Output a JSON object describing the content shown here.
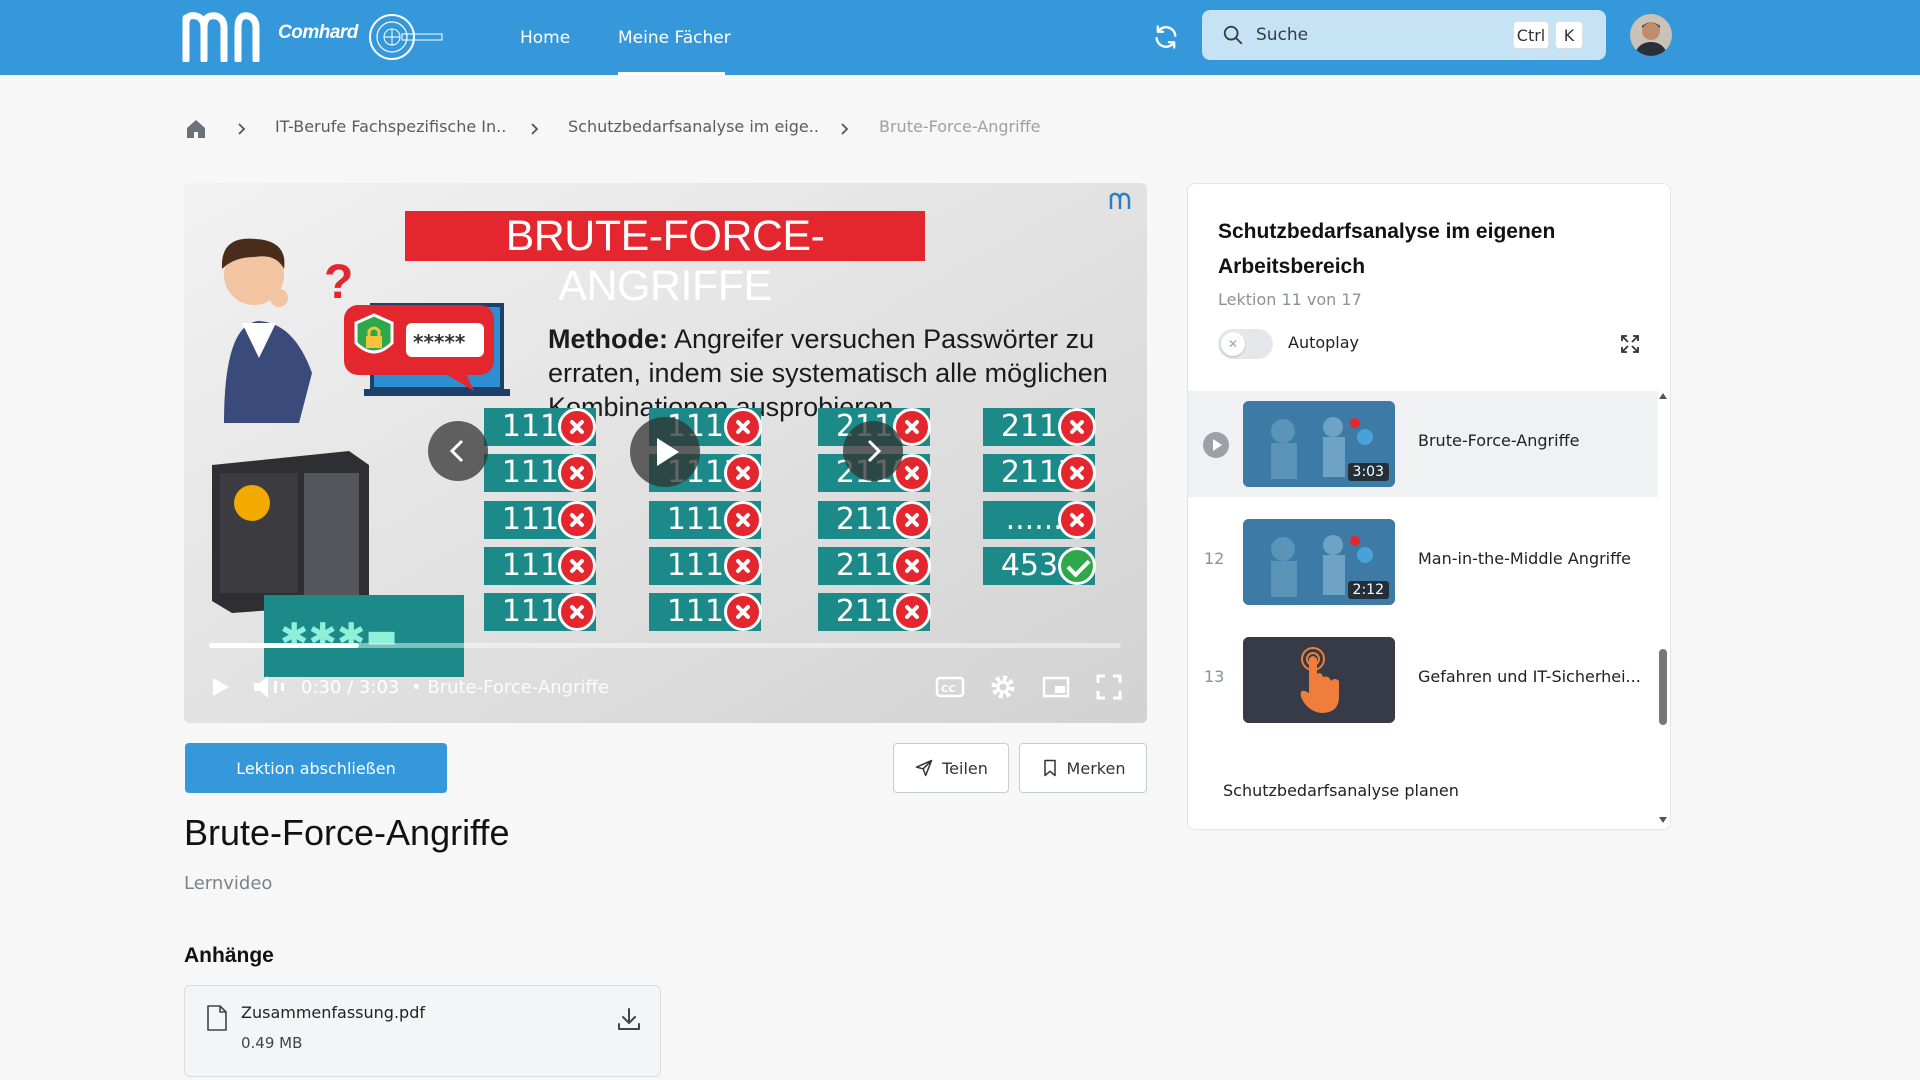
{
  "header": {
    "brand": "Comhard",
    "nav": [
      {
        "label": "Home"
      },
      {
        "label": "Meine Fächer"
      }
    ],
    "search": {
      "placeholder": "Suche",
      "key1": "Ctrl",
      "key2": "K"
    }
  },
  "breadcrumb": [
    {
      "label": "IT-Berufe Fachspezifische In.."
    },
    {
      "label": "Schutzbedarfsanalyse im eige.."
    },
    {
      "label": "Brute-Force-Angriffe"
    }
  ],
  "video": {
    "title": "BRUTE-FORCE-ANGRIFFE",
    "method_label": "Methode:",
    "method_text": "Angreifer versuchen Passwörter zu erraten, indem sie systematisch alle möglichen Kombinationen ausprobieren",
    "password_mask": "*****",
    "codes": [
      [
        "1111",
        "1116",
        "2111",
        "2116"
      ],
      [
        "1112",
        "1117",
        "2112",
        "2117"
      ],
      [
        "1113",
        "1118",
        "2113",
        "......."
      ],
      [
        "1114",
        "1119",
        "2114",
        "4539"
      ],
      [
        "1115",
        "1110",
        "2115",
        ""
      ]
    ],
    "time": "0:30 / 3:03",
    "chapter": "• Brute-Force-Angriffe",
    "progress_fraction": 0.164
  },
  "actions": {
    "complete": "Lektion abschließen",
    "share": "Teilen",
    "bookmark": "Merken"
  },
  "lesson": {
    "title": "Brute-Force-Angriffe",
    "type": "Lernvideo"
  },
  "attachments": {
    "heading": "Anhänge",
    "files": [
      {
        "name": "Zusammenfassung.pdf",
        "size": "0.49 MB"
      }
    ]
  },
  "course_panel": {
    "title": "Schutzbedarfsanalyse im eigenen Arbeitsbereich",
    "lesson_count": "Lektion 11 von 17",
    "autoplay_label": "Autoplay",
    "items": [
      {
        "index": "",
        "title": "Brute-Force-Angriffe",
        "duration": "3:03",
        "active": true
      },
      {
        "index": "12",
        "title": "Man-in-the-Middle Angriffe",
        "duration": "2:12",
        "active": false
      },
      {
        "index": "13",
        "title": "Gefahren und IT-Sicherhei...",
        "duration": "",
        "active": false
      }
    ],
    "next_section": "Schutzbedarfsanalyse planen"
  },
  "colors": {
    "accent": "#3498db",
    "title_red": "#e4262e",
    "code_teal": "#1b8a88"
  }
}
